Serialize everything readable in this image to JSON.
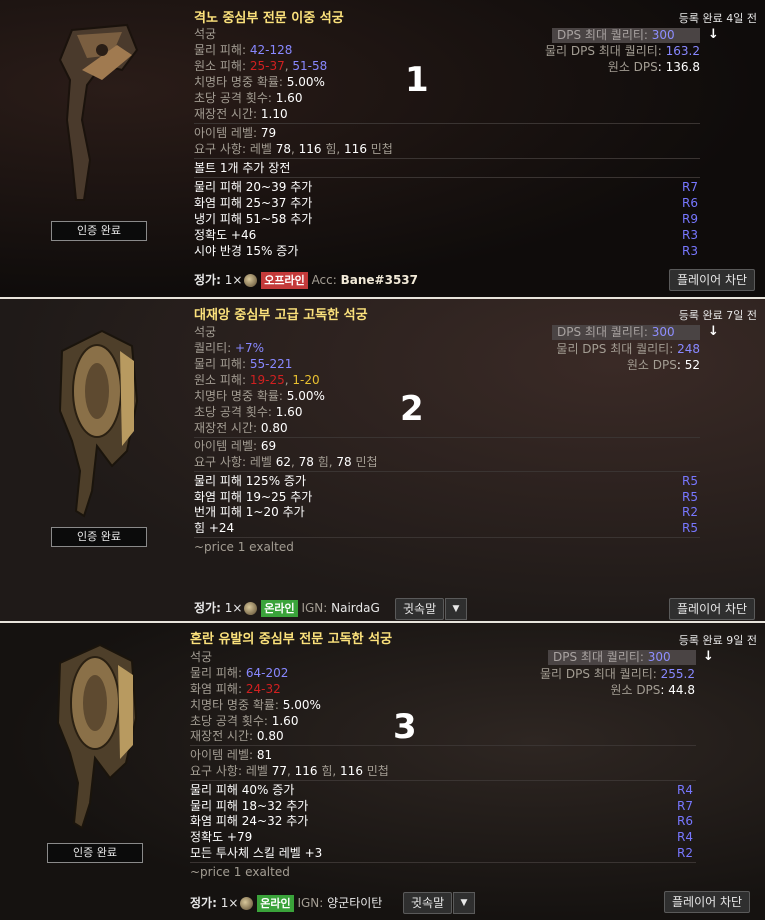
{
  "listings": [
    {
      "number": "1",
      "title": "격노 중심부 전문 이중 석궁",
      "listed": "등록 완료 4일 전",
      "verified": "인증 완료",
      "base": "석궁",
      "phys_label": "물리 피해: ",
      "phys_value": "42-128",
      "elem_label": "원소 피해: ",
      "elem_fire": "25-37",
      "elem_sep": ", ",
      "elem_cold": "51-58",
      "crit_label": "치명타 명중 확률: ",
      "crit_value": "5.00%",
      "aps_label": "초당 공격 횟수: ",
      "aps_value": "1.60",
      "reload_label": "재장전 시간: ",
      "reload_value": "1.10",
      "ilvl_label": "아이템 레벨: ",
      "ilvl_value": "79",
      "req_label": "요구 사항: 레벨 ",
      "req_level": "78",
      "req_str": "116",
      "req_str_label": " 힘, ",
      "req_dex": "116",
      "req_dex_label": " 민첩",
      "implicit": "볼트 1개 추가 장전",
      "mods": [
        {
          "text": "물리 피해 20~39 추가",
          "tier": "R7"
        },
        {
          "text": "화염 피해 25~37 추가",
          "tier": "R6"
        },
        {
          "text": "냉기 피해 51~58 추가",
          "tier": "R9"
        },
        {
          "text": "정확도 +46",
          "tier": "R3"
        },
        {
          "text": "시야 반경 15% 증가",
          "tier": "R3"
        }
      ],
      "dps_max_label": "DPS 최대 퀄리티: ",
      "dps_max_value": "300",
      "phys_dps_label": "물리 DPS 최대 퀄리티: ",
      "phys_dps_value": "163.2",
      "elem_dps_label": "원소 DPS",
      "elem_dps_value": ": 136.8",
      "price_label": "정가:",
      "price_qty": "1×",
      "status": "오프라인",
      "account_label": "Acc: ",
      "account": "Bane#3537",
      "block": "플레이어 차단"
    },
    {
      "number": "2",
      "title": "대재앙 중심부 고급 고독한 석궁",
      "listed": "등록 완료 7일 전",
      "verified": "인증 완료",
      "base": "석궁",
      "quality_label": "퀄리티: ",
      "quality_value": "+7%",
      "phys_label": "물리 피해: ",
      "phys_value": "55-221",
      "elem_label": "원소 피해: ",
      "elem_fire": "19-25",
      "elem_sep": ", ",
      "elem_light": "1-20",
      "crit_label": "치명타 명중 확률: ",
      "crit_value": "5.00%",
      "aps_label": "초당 공격 횟수: ",
      "aps_value": "1.60",
      "reload_label": "재장전 시간: ",
      "reload_value": "0.80",
      "ilvl_label": "아이템 레벨: ",
      "ilvl_value": "69",
      "req_label": "요구 사항: 레벨 ",
      "req_level": "62",
      "req_str": "78",
      "req_str_label": " 힘, ",
      "req_dex": "78",
      "req_dex_label": " 민첩",
      "mods": [
        {
          "text": "물리 피해 125% 증가",
          "tier": "R5"
        },
        {
          "text": "화염 피해 19~25 추가",
          "tier": "R5"
        },
        {
          "text": "번개 피해 1~20 추가",
          "tier": "R2"
        },
        {
          "text": "힘 +24",
          "tier": "R5"
        }
      ],
      "note": "~price 1 exalted",
      "dps_max_label": "DPS 최대 퀄리티: ",
      "dps_max_value": "300",
      "phys_dps_label": "물리 DPS 최대 퀄리티: ",
      "phys_dps_value": "248",
      "elem_dps_label": "원소 DPS",
      "elem_dps_value": ": 52",
      "price_label": "정가:",
      "price_qty": "1×",
      "status": "온라인",
      "ign_label": "IGN: ",
      "ign": "NairdaG",
      "whisper": "귓속말",
      "block": "플레이어 차단"
    },
    {
      "number": "3",
      "title": "혼란 유발의 중심부 전문 고독한 석궁",
      "listed": "등록 완료 9일 전",
      "verified": "인증 완료",
      "base": "석궁",
      "phys_label": "물리 피해: ",
      "phys_value": "64-202",
      "fire_label": "화염 피해: ",
      "fire_value": "24-32",
      "crit_label": "치명타 명중 확률: ",
      "crit_value": "5.00%",
      "aps_label": "초당 공격 횟수: ",
      "aps_value": "1.60",
      "reload_label": "재장전 시간: ",
      "reload_value": "0.80",
      "ilvl_label": "아이템 레벨: ",
      "ilvl_value": "81",
      "req_label": "요구 사항: 레벨 ",
      "req_level": "77",
      "req_str": "116",
      "req_str_label": " 힘, ",
      "req_dex": "116",
      "req_dex_label": " 민첩",
      "mods": [
        {
          "text": "물리 피해 40% 증가",
          "tier": "R4"
        },
        {
          "text": "물리 피해 18~32 추가",
          "tier": "R7"
        },
        {
          "text": "화염 피해 24~32 추가",
          "tier": "R6"
        },
        {
          "text": "정확도 +79",
          "tier": "R4"
        },
        {
          "text": "모든 투사체 스킬 레벨 +3",
          "tier": "R2"
        }
      ],
      "note": "~price 1 exalted",
      "dps_max_label": "DPS 최대 퀄리티: ",
      "dps_max_value": "300",
      "phys_dps_label": "물리 DPS 최대 퀄리티: ",
      "phys_dps_value": "255.2",
      "elem_dps_label": "원소 DPS",
      "elem_dps_value": ": 44.8",
      "price_label": "정가:",
      "price_qty": "1×",
      "status": "온라인",
      "ign_label": "IGN: ",
      "ign": "양군타이탄",
      "whisper": "귓속말",
      "block": "플레이어 차단"
    }
  ],
  "icons": {
    "sort": "down-arrow-icon",
    "currency": "exalted-orb-icon",
    "caret": "caret-down-icon"
  },
  "colors": {
    "title": "#fce27c",
    "stat_value": "#8888ff",
    "fire": "#d02020",
    "lightning": "#e8c030",
    "offline": "#c43a3a",
    "online": "#3aa33a"
  }
}
